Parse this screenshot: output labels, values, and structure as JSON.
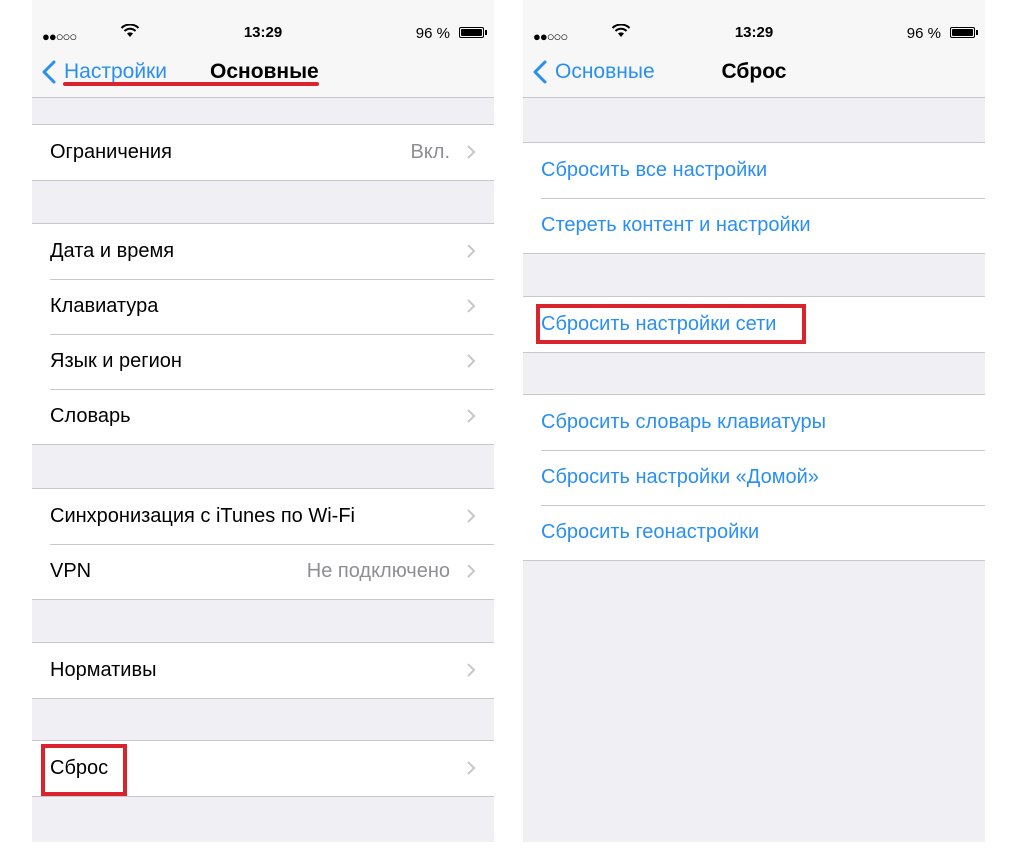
{
  "left": {
    "status": {
      "signal": "●●○○○",
      "time": "13:29",
      "battery": "96 %",
      "battery_level": 0.96
    },
    "nav": {
      "back_label": "Настройки",
      "title": "Основные"
    },
    "groups": [
      [
        {
          "label": "Ограничения",
          "detail": "Вкл."
        }
      ],
      [
        {
          "label": "Дата и время"
        },
        {
          "label": "Клавиатура"
        },
        {
          "label": "Язык и регион"
        },
        {
          "label": "Словарь"
        }
      ],
      [
        {
          "label": "Синхронизация с iTunes по Wi-Fi"
        },
        {
          "label": "VPN",
          "detail": "Не подключено"
        }
      ],
      [
        {
          "label": "Нормативы"
        }
      ],
      [
        {
          "label": "Сброс"
        }
      ]
    ]
  },
  "right": {
    "status": {
      "signal": "●●○○○",
      "time": "13:29",
      "battery": "96 %",
      "battery_level": 0.96
    },
    "nav": {
      "back_label": "Основные",
      "title": "Сброс"
    },
    "groups": [
      [
        {
          "label": "Сбросить все настройки"
        },
        {
          "label": "Стереть контент и настройки"
        }
      ],
      [
        {
          "label": "Сбросить настройки сети"
        }
      ],
      [
        {
          "label": "Сбросить словарь клавиатуры"
        },
        {
          "label": "Сбросить настройки «Домой»"
        },
        {
          "label": "Сбросить геонастройки"
        }
      ]
    ]
  },
  "colors": {
    "accent": "#2a8ff2",
    "highlight": "#d9232d",
    "background": "#efeff4"
  },
  "icons": {
    "back": "chevron-left-icon",
    "row": "chevron-right-icon",
    "wifi": "wifi-icon",
    "battery": "battery-icon"
  }
}
